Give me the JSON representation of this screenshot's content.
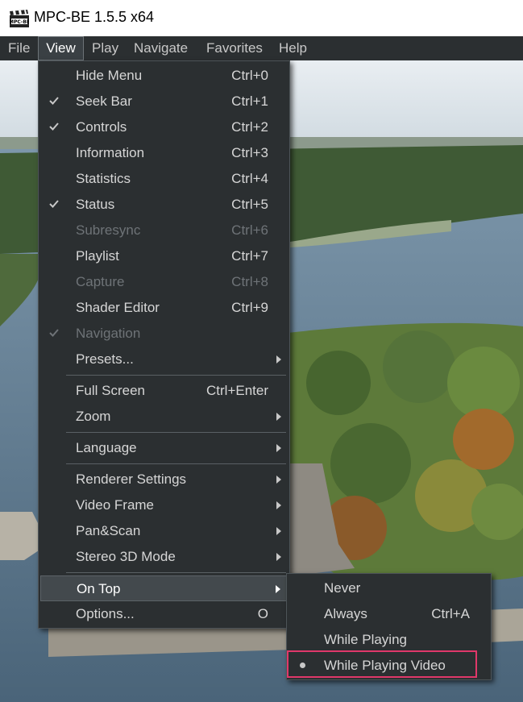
{
  "window": {
    "title": "MPC-BE 1.5.5 x64",
    "icon": "mpc-be-clapperboard-icon"
  },
  "menubar": {
    "items": [
      {
        "label": "File"
      },
      {
        "label": "View"
      },
      {
        "label": "Play"
      },
      {
        "label": "Navigate"
      },
      {
        "label": "Favorites"
      },
      {
        "label": "Help"
      }
    ]
  },
  "view_menu": {
    "items": [
      {
        "label": "Hide Menu",
        "shortcut": "Ctrl+0",
        "checked": false,
        "enabled": true
      },
      {
        "label": "Seek Bar",
        "shortcut": "Ctrl+1",
        "checked": true,
        "enabled": true
      },
      {
        "label": "Controls",
        "shortcut": "Ctrl+2",
        "checked": true,
        "enabled": true
      },
      {
        "label": "Information",
        "shortcut": "Ctrl+3",
        "checked": false,
        "enabled": true
      },
      {
        "label": "Statistics",
        "shortcut": "Ctrl+4",
        "checked": false,
        "enabled": true
      },
      {
        "label": "Status",
        "shortcut": "Ctrl+5",
        "checked": true,
        "enabled": true
      },
      {
        "label": "Subresync",
        "shortcut": "Ctrl+6",
        "checked": false,
        "enabled": false
      },
      {
        "label": "Playlist",
        "shortcut": "Ctrl+7",
        "checked": false,
        "enabled": true
      },
      {
        "label": "Capture",
        "shortcut": "Ctrl+8",
        "checked": false,
        "enabled": false
      },
      {
        "label": "Shader Editor",
        "shortcut": "Ctrl+9",
        "checked": false,
        "enabled": true
      },
      {
        "label": "Navigation",
        "shortcut": "",
        "checked": true,
        "enabled": false
      },
      {
        "label": "Presets...",
        "submenu": true
      },
      {
        "label": "Full Screen",
        "shortcut": "Ctrl+Enter"
      },
      {
        "label": "Zoom",
        "submenu": true
      },
      {
        "label": "Language",
        "submenu": true
      },
      {
        "label": "Renderer Settings",
        "submenu": true
      },
      {
        "label": "Video Frame",
        "submenu": true
      },
      {
        "label": "Pan&Scan",
        "submenu": true
      },
      {
        "label": "Stereo 3D Mode",
        "submenu": true
      },
      {
        "label": "On Top",
        "submenu": true,
        "highlighted": true
      },
      {
        "label": "Options...",
        "shortcut": "O"
      }
    ]
  },
  "on_top_menu": {
    "items": [
      {
        "label": "Never",
        "shortcut": ""
      },
      {
        "label": "Always",
        "shortcut": "Ctrl+A"
      },
      {
        "label": "While Playing",
        "shortcut": ""
      },
      {
        "label": "While Playing Video",
        "shortcut": "",
        "selected": true
      }
    ]
  },
  "colors": {
    "menu_bg": "#2b2f31",
    "menu_text": "#d6d6d6",
    "disabled_text": "#6e7377",
    "highlight_bg": "#43494d",
    "focus_outline": "#e0386a"
  }
}
